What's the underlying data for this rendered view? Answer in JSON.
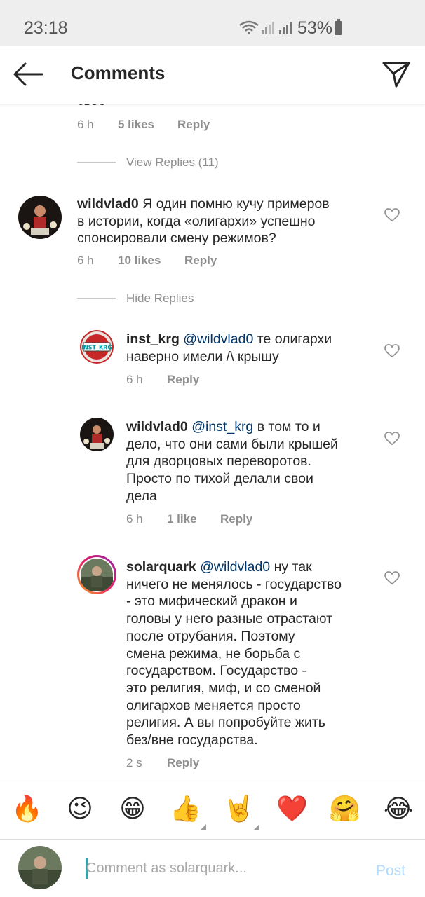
{
  "status_bar": {
    "time": "23:18",
    "battery": "53%"
  },
  "header": {
    "title": "Comments"
  },
  "top_comment_tail": {
    "cut_text": "свое",
    "time": "6 h",
    "likes": "5 likes",
    "reply": "Reply",
    "view_replies": "View Replies (11)"
  },
  "comments": [
    {
      "username": "wildvlad0",
      "lines": [
        "Я один помню кучу примеров",
        "в истории, когда «олигархи» успешно",
        "спонсировали смену режимов?"
      ],
      "time": "6 h",
      "likes": "10 likes",
      "reply": "Reply",
      "hide_replies": "Hide Replies"
    }
  ],
  "replies": [
    {
      "username": "inst_krg",
      "mention": "@wildvlad0",
      "first_line_rest": "те олигархи",
      "lines": [
        "наверно имели /\\ крышу"
      ],
      "time": "6 h",
      "reply": "Reply",
      "avatar_text": "INST_KRG"
    },
    {
      "username": "wildvlad0",
      "mention": "@inst_krg",
      "first_line_rest": "в том то и",
      "lines": [
        "дело, что они сами были крышей",
        "для дворцовых переворотов.",
        "Просто по тихой делали свои",
        "дела"
      ],
      "time": "6 h",
      "likes": "1 like",
      "reply": "Reply"
    },
    {
      "username": "solarquark",
      "mention": "@wildvlad0",
      "first_line_rest": "ну так",
      "lines": [
        "ничего не менялось - государство",
        "- это мифический дракон и",
        "головы у него разные отрастают",
        "после отрубания. Поэтому",
        "смена режима, не борьба с",
        "государством. Государство -",
        "это религия, миф, и со сменой",
        "олигархов меняется просто",
        "религия. А вы попробуйте жить",
        "без/вне государства."
      ],
      "time": "2 s",
      "reply": "Reply"
    }
  ],
  "emoji_bar": [
    "🔥",
    "😉",
    "😁",
    "👍",
    "🤘",
    "❤️",
    "🤗",
    "😂"
  ],
  "composer": {
    "placeholder": "Comment as solarquark...",
    "post": "Post"
  },
  "colors": {
    "link_blue": "#003569",
    "post_disabled": "#b3dbff",
    "meta_gray": "#8e8e8e",
    "cursor": "#3aa0a5"
  }
}
